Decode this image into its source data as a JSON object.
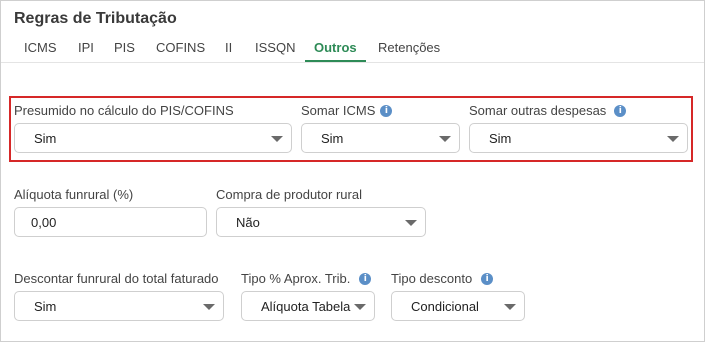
{
  "title": "Regras de Tributação",
  "tabs": [
    {
      "label": "ICMS"
    },
    {
      "label": "IPI"
    },
    {
      "label": "PIS"
    },
    {
      "label": "COFINS"
    },
    {
      "label": "II"
    },
    {
      "label": "ISSQN"
    },
    {
      "label": "Outros"
    },
    {
      "label": "Retenções"
    }
  ],
  "active_tab": "Outros",
  "fields": {
    "presumido": {
      "label": "Presumido no cálculo do PIS/COFINS",
      "value": "Sim"
    },
    "somar_icms": {
      "label": "Somar ICMS",
      "value": "Sim"
    },
    "somar_outras": {
      "label": "Somar outras despesas",
      "value": "Sim"
    },
    "aliquota_funrural": {
      "label": "Alíquota funrural (%)",
      "value": "0,00"
    },
    "compra_produtor": {
      "label": "Compra de produtor rural",
      "value": "Não"
    },
    "descontar_funrural": {
      "label": "Descontar funrural do total faturado",
      "value": "Sim"
    },
    "tipo_aprox": {
      "label": "Tipo % Aprox. Trib.",
      "value": "Alíquota Tabela"
    },
    "tipo_desconto": {
      "label": "Tipo desconto",
      "value": "Condicional"
    }
  },
  "icons": {
    "info": "info-icon",
    "dropdown": "chevron-down-icon"
  },
  "colors": {
    "accent": "#2e8b57",
    "highlight": "#d62828",
    "info": "#5b8fc7"
  }
}
